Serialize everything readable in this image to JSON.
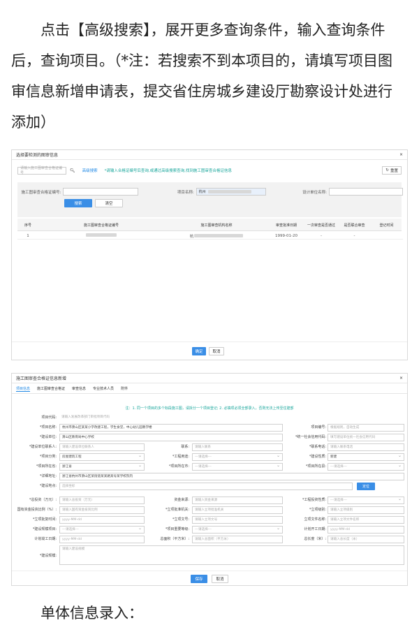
{
  "intro": {
    "lines": [
      "点击【高级搜索】，展开更多查询条件，输入查询条件",
      "后，查询项目。（*注：若搜索不到本项目的，请填写项目图",
      "审信息新增申请表，提交省住房城乡建设厅勘察设计处进行",
      "添加）"
    ]
  },
  "dialog1": {
    "title": "选择要检测的图审信息",
    "search_placeholder": "请输入施工图审查合格证编号",
    "advanced_link": "高级搜索",
    "hint": "*请输入合格证编号后查询,或通过高级搜索查询,找到施工图审查合格证信息",
    "reset_label": "重置",
    "filter_cert_label": "施工图审查合格证编号:",
    "filter_project_label": "项目名称:",
    "filter_project_value": "杭州",
    "filter_design_label": "设计单位名称:",
    "search_btn": "搜索",
    "clear_btn": "清空",
    "columns": [
      "序号",
      "施工图审查合格证编号",
      "施工图审查机构名称",
      "审查批准日期",
      "一次审查是否通过",
      "是否联合审查",
      "登记时间"
    ],
    "rows": [
      {
        "index": "1",
        "agency_prefix": "杭",
        "date": "1999-01-20",
        "first_pass": "-",
        "joint": "-"
      }
    ],
    "confirm_btn": "确定",
    "cancel_btn": "取消"
  },
  "dialog2": {
    "title": "施工图审查合格证信息新增",
    "tabs": [
      "项目信息",
      "施工图审查合格证",
      "审查信息",
      "专业技术人员",
      "附件"
    ],
    "notice": "注：1. 同一个项目的多个标段施工图，请拆分一个项目登记; 2. 必填项必须全部录入，否则无法上传至住建部",
    "fields": {
      "project_code_label": "项目代码:",
      "project_code_ph": "请输入发展改革部门审批项目代码",
      "project_name_label": "*项目名称:",
      "project_name_val": "杭州市萧山区某某小学改建工程，学生食堂，中心幼儿园教学楼",
      "project_no_label": "项目编号:",
      "project_no_ph": "根据规则，自动生成",
      "build_unit_label": "*建设单位:",
      "build_unit_val": "萧山区教育局中心学校",
      "credit_code_label": "*统一社会信用代码:",
      "credit_code_ph": "填写建设单位统一社会信用代码",
      "legal_label": "*建设单位联系人:",
      "legal_ph": "请输入建设单位联系人",
      "phone_label": "联系:",
      "phone_ph": "请输入联系",
      "contact_label": "*联系电话:",
      "contact_ph": "请输入联系电话",
      "category_label": "*项目分类:",
      "category_val": "房屋建筑工程",
      "use_label": "*工程用途:",
      "use_ph": "---请选择---",
      "nature_label": "*建设性质:",
      "nature_val": "新建",
      "status_label": "*项目所在省:",
      "status_val": "浙江省",
      "city_label": "*项目所在市:",
      "city_ph": "---请选择---",
      "county_label": "*项目所在县:",
      "county_ph": "---请选择---",
      "address_label": "*详细地址:",
      "address_val": "浙江省杭州市萧山区某街道某某路某号某学校院内",
      "location_label": "*建设地点:",
      "location_ph": "选择坐标",
      "locate_btn": "定位",
      "invest_label": "*总投资（万元）:",
      "invest_ph": "请输入总投资（万元）",
      "fund_label": "资金来源:",
      "fund_ph": "请输入资金来源",
      "level_label": "*工程投资性质:",
      "level_ph": "---请选择---",
      "gov_ratio_label": "国有资金投资比例（%）:",
      "gov_ratio_ph": "请输入国有资金投资比例",
      "approve_no_label": "*立项批准机关:",
      "approve_no_ph": "请输入立项批准机关",
      "approve_org_label": "*立项级别:",
      "approve_org_ph": "请输入立项级别",
      "approve_date_label": "*立项批复时间:",
      "approve_date_ph": "yyyy-MM-dd",
      "approve_doc_label": "*立项文号:",
      "approve_doc_ph": "请输入立项文号",
      "doc_label": "立项文件名称:",
      "doc_ph": "请输入立项文件名称",
      "scale_label": "*建设规模项目:",
      "scale_ph": "---请选择---",
      "major_label": "*项目重要等级:",
      "major_ph": "---请选择---",
      "start_label": "计划开工日期:",
      "start_ph": "yyyy-MM-dd",
      "end_label": "计划竣工日期:",
      "end_ph": "yyyy-MM-dd",
      "area_label": "总面积（平方米）:",
      "area_ph": "请输入总面积（平方米）",
      "length_label": "总长度（米）:",
      "length_ph": "请输入总长度（米）",
      "desc_label": "*建设规模:",
      "desc_ph": "请输入建设规模"
    },
    "save_btn": "保存",
    "cancel_btn": "取消"
  },
  "footer": {
    "text": "单体信息录入："
  }
}
